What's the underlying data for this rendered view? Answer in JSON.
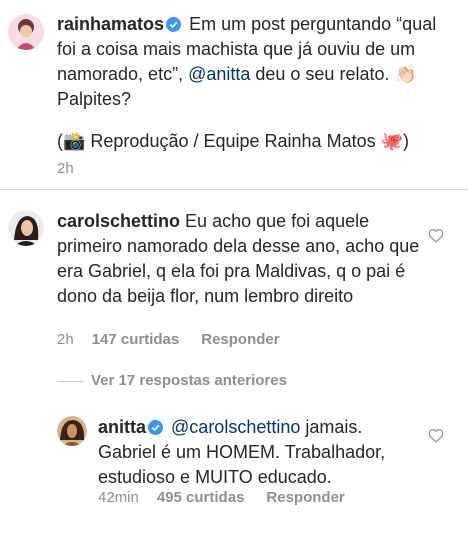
{
  "post": {
    "username": "rainhamatos",
    "caption_before_mention": "Em um post perguntando “qual foi a coisa mais machista que já ouviu de um namorado, etc”, ",
    "mention": "@anitta",
    "caption_after_mention": " deu o seu relato. 👏🏻 Palpites?",
    "credit": "(📸 Reprodução / Equipe Rainha Matos 🐙)",
    "time": "2h"
  },
  "comment": {
    "username": "carolschettino",
    "text": "Eu acho que foi aquele primeiro namorado dela desse ano, acho que era Gabriel, q ela foi pra Maldivas, q o pai é dono da beija flor, num lembro direito",
    "time": "2h",
    "likes": "147 curtidas",
    "reply_label": "Responder"
  },
  "view_replies": "Ver 17 respostas anteriores",
  "reply": {
    "username": "anitta",
    "mention": "@carolschettino",
    "text": " jamais. Gabriel é um HOMEM. Trabalhador, estudioso e MUITO educado.",
    "time": "42min",
    "likes": "495 curtidas",
    "reply_label": "Responder"
  },
  "colors": {
    "text": "#262626",
    "muted": "#8e8e8e",
    "mention": "#00376b",
    "verified": "#3897f0",
    "divider": "#dbdbdb"
  },
  "icons": [
    "verified-badge-icon",
    "heart-outline-icon"
  ]
}
